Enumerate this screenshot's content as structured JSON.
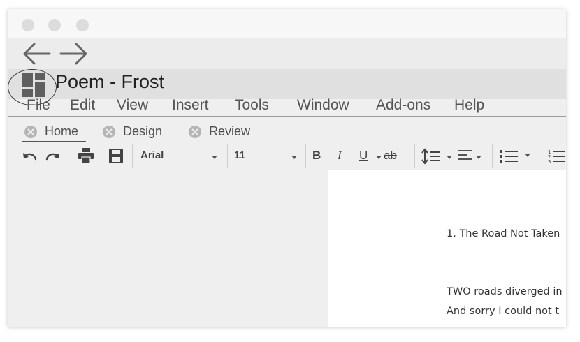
{
  "document": {
    "title": "Poem - Frost"
  },
  "menu": [
    "File",
    "Edit",
    "View",
    "Insert",
    "Tools",
    "Window",
    "Add-ons",
    "Help"
  ],
  "tabs": [
    "Home",
    "Design",
    "Review"
  ],
  "toolbar": {
    "font_name": "Arial",
    "font_size": "11",
    "bold": "B",
    "italic": "I",
    "underline": "U",
    "strikethrough": "ab"
  },
  "page": {
    "heading": "1. The Road Not Taken",
    "lines": [
      "TWO roads diverged in",
      "And sorry I could not t"
    ]
  },
  "icons": {
    "back": "arrow-left-icon",
    "forward": "arrow-right-icon",
    "app": "layout-grid-icon",
    "tab_close": "close-circle-icon",
    "undo": "undo-icon",
    "redo": "redo-icon",
    "print": "printer-icon",
    "save": "floppy-disk-icon",
    "line_spacing": "line-spacing-icon",
    "align": "align-left-icon",
    "bullets": "bulleted-list-icon",
    "numbering": "numbered-list-icon"
  }
}
